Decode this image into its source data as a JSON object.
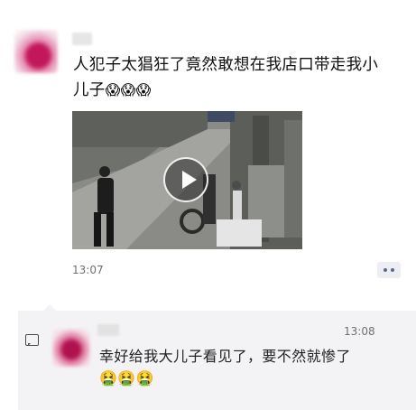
{
  "post": {
    "text": "人犯子太猖狂了竟然敢想在我店口带走我小儿子",
    "emojis": [
      "😱",
      "😱",
      "😱"
    ],
    "time": "13:07"
  },
  "comment": {
    "time": "13:08",
    "text": "幸好给我大儿子看见了，要不然就惨了",
    "emojis": [
      "🤮",
      "🤮",
      "🤮"
    ]
  },
  "icons": {
    "play": "play-icon",
    "more": "more-dots-icon",
    "comment": "comment-icon"
  }
}
